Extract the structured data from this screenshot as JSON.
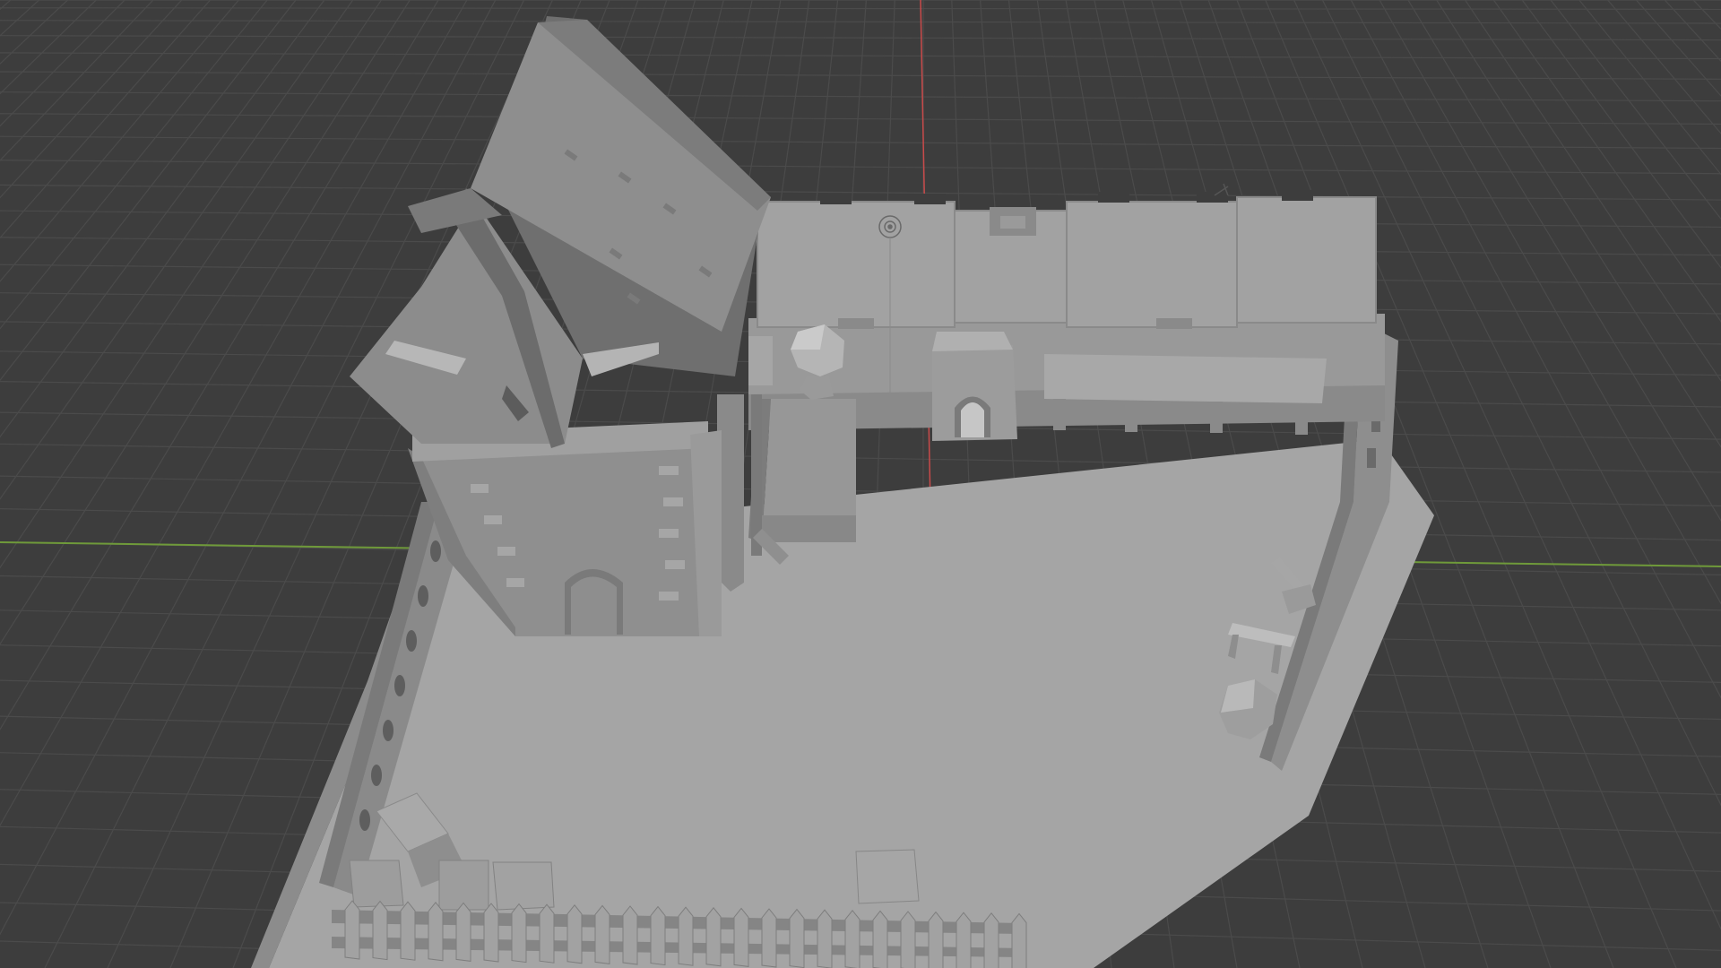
{
  "viewport": {
    "mode": "3D viewport",
    "shading": "solid",
    "colors": {
      "background": "#3d3d3d",
      "grid_line": "#4a4a4a",
      "x_axis": "#c94a4a",
      "y_axis": "#6f9a3a",
      "model_base": "#a3a3a3",
      "model_wall": "#959595",
      "model_dark": "#7a7a7a",
      "roof_light": "#8e8e8e",
      "roof_dark": "#6e6e6e"
    }
  },
  "scene": {
    "objects": [
      "ground-plate",
      "tower",
      "tower-roof",
      "rear-wall",
      "battlements",
      "gatehouse",
      "side-wall-left",
      "side-wall-right",
      "front-fence",
      "crates",
      "boulders",
      "hammer",
      "table",
      "light-empty"
    ]
  }
}
